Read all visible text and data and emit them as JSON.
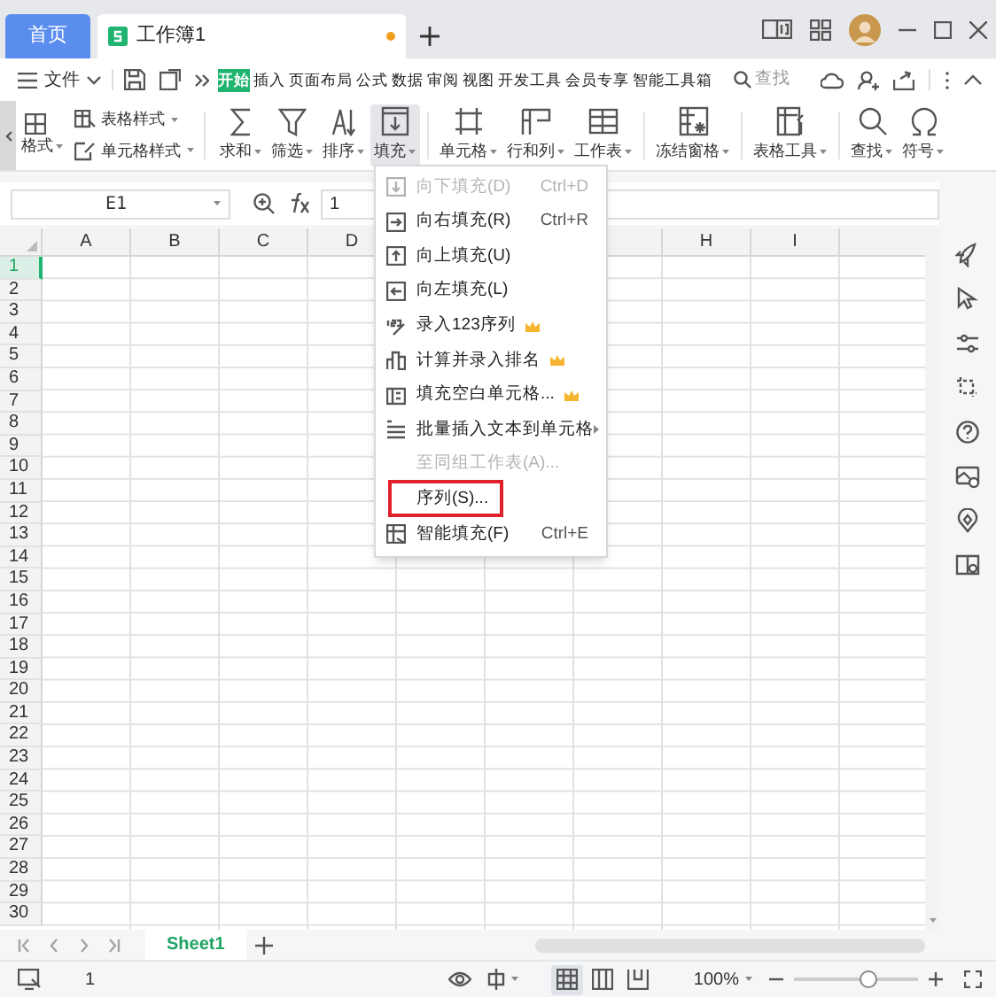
{
  "title_bar": {
    "tabs": [
      {
        "label": "首页",
        "kind": "home",
        "selected": false
      },
      {
        "label": "工作簿1",
        "kind": "document",
        "selected": true,
        "unsaved": true
      }
    ]
  },
  "menu_bar": {
    "file_label": "文件",
    "tabs": [
      {
        "label": "开始",
        "selected": true
      },
      {
        "label": "插入",
        "selected": false
      },
      {
        "label": "页面布局",
        "selected": false
      },
      {
        "label": "公式",
        "selected": false
      },
      {
        "label": "数据",
        "selected": false
      },
      {
        "label": "审阅",
        "selected": false
      },
      {
        "label": "视图",
        "selected": false
      },
      {
        "label": "开发工具",
        "selected": false
      },
      {
        "label": "会员专享",
        "selected": false
      },
      {
        "label": "智能工具箱",
        "selected": false
      }
    ],
    "search_placeholder": "查找"
  },
  "ribbon": {
    "cut_label": "格式",
    "small_buttons": [
      "表格样式",
      "单元格样式"
    ],
    "buttons": [
      {
        "label": "求和",
        "pressed": false
      },
      {
        "label": "筛选",
        "pressed": false
      },
      {
        "label": "排序",
        "pressed": false
      },
      {
        "label": "填充",
        "pressed": true
      },
      {
        "label": "单元格",
        "pressed": false
      },
      {
        "label": "行和列",
        "pressed": false
      },
      {
        "label": "工作表",
        "pressed": false
      },
      {
        "label": "冻结窗格",
        "pressed": false
      },
      {
        "label": "表格工具",
        "pressed": false
      },
      {
        "label": "查找",
        "pressed": false
      },
      {
        "label": "符号",
        "pressed": false
      }
    ]
  },
  "formula_bar": {
    "name_box": "E1",
    "formula": "1"
  },
  "columns_left": [
    "A",
    "B",
    "C",
    "D"
  ],
  "columns_right": [
    "H",
    "I"
  ],
  "rows": [
    {
      "label": "1",
      "selected": true
    },
    {
      "label": "2",
      "selected": false
    },
    {
      "label": "3",
      "selected": false
    },
    {
      "label": "4",
      "selected": false
    },
    {
      "label": "5",
      "selected": false
    },
    {
      "label": "6",
      "selected": false
    },
    {
      "label": "7",
      "selected": false
    },
    {
      "label": "8",
      "selected": false
    },
    {
      "label": "9",
      "selected": false
    },
    {
      "label": "10",
      "selected": false
    },
    {
      "label": "11",
      "selected": false
    },
    {
      "label": "12",
      "selected": false
    },
    {
      "label": "13",
      "selected": false
    },
    {
      "label": "14",
      "selected": false
    },
    {
      "label": "15",
      "selected": false
    },
    {
      "label": "16",
      "selected": false
    },
    {
      "label": "17",
      "selected": false
    },
    {
      "label": "18",
      "selected": false
    },
    {
      "label": "19",
      "selected": false
    },
    {
      "label": "20",
      "selected": false
    },
    {
      "label": "21",
      "selected": false
    },
    {
      "label": "22",
      "selected": false
    },
    {
      "label": "23",
      "selected": false
    },
    {
      "label": "24",
      "selected": false
    },
    {
      "label": "25",
      "selected": false
    },
    {
      "label": "26",
      "selected": false
    },
    {
      "label": "27",
      "selected": false
    },
    {
      "label": "28",
      "selected": false
    },
    {
      "label": "29",
      "selected": false
    },
    {
      "label": "30",
      "selected": false
    }
  ],
  "fill_menu": [
    {
      "label": "向下填充(D)",
      "shortcut": "Ctrl+D",
      "disabled": true,
      "premium": false,
      "submenu": false,
      "highlighted": false
    },
    {
      "label": "向右填充(R)",
      "shortcut": "Ctrl+R",
      "disabled": false,
      "premium": false,
      "submenu": false,
      "highlighted": false
    },
    {
      "label": "向上填充(U)",
      "disabled": false,
      "premium": false,
      "submenu": false,
      "highlighted": false
    },
    {
      "label": "向左填充(L)",
      "disabled": false,
      "premium": false,
      "submenu": false,
      "highlighted": false
    },
    {
      "label": "录入123序列",
      "disabled": false,
      "premium": true,
      "submenu": false,
      "highlighted": false
    },
    {
      "label": "计算并录入排名",
      "disabled": false,
      "premium": true,
      "submenu": false,
      "highlighted": false
    },
    {
      "label": "填充空白单元格...",
      "disabled": false,
      "premium": true,
      "submenu": false,
      "highlighted": false
    },
    {
      "label": "批量插入文本到单元格",
      "disabled": false,
      "premium": false,
      "submenu": true,
      "highlighted": false
    },
    {
      "label": "至同组工作表(A)...",
      "disabled": true,
      "premium": false,
      "submenu": false,
      "highlighted": false
    },
    {
      "label": "序列(S)...",
      "disabled": false,
      "premium": false,
      "submenu": false,
      "highlighted": true
    },
    {
      "label": "智能填充(F)",
      "shortcut": "Ctrl+E",
      "disabled": false,
      "premium": false,
      "submenu": false,
      "highlighted": false
    }
  ],
  "sheet_tabs": [
    {
      "label": "Sheet1",
      "selected": true
    }
  ],
  "status_bar": {
    "page": "1",
    "views": [
      {
        "kind": "normal",
        "selected": true
      },
      {
        "kind": "page",
        "selected": false
      },
      {
        "kind": "layout",
        "selected": false
      }
    ],
    "zoom": "100%",
    "zoom_slider": {
      "level": 0.6
    }
  }
}
